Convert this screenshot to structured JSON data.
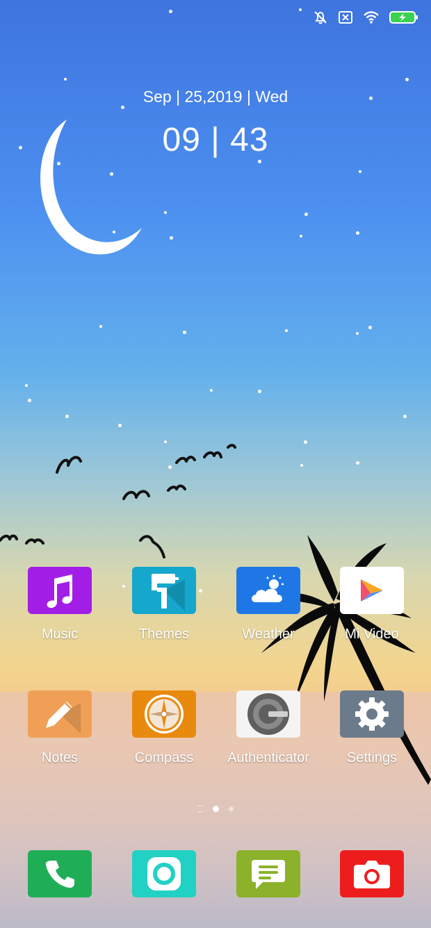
{
  "status_bar": {
    "icons": [
      "mute-icon",
      "no-sim-icon",
      "wifi-icon",
      "battery-charging-icon"
    ]
  },
  "clock": {
    "date": "Sep | 25,2019 | Wed",
    "time": "09 | 43"
  },
  "apps": [
    {
      "label": "Music",
      "icon": "music-note-icon",
      "color": "#a21ee6"
    },
    {
      "label": "Themes",
      "icon": "paint-roller-icon",
      "color": "#16a7cc"
    },
    {
      "label": "Weather",
      "icon": "weather-cloud-sun-icon",
      "color": "#1f77e6"
    },
    {
      "label": "Mi Video",
      "icon": "play-icon",
      "color": "#ffffff"
    },
    {
      "label": "Notes",
      "icon": "pencil-icon",
      "color": "#f0a056"
    },
    {
      "label": "Compass",
      "icon": "compass-icon",
      "color": "#e88a0e"
    },
    {
      "label": "Authenticator",
      "icon": "authenticator-icon",
      "color": "#f4f4f4"
    },
    {
      "label": "Settings",
      "icon": "gear-icon",
      "color": "#6b7b8b"
    }
  ],
  "dock": [
    {
      "name": "phone",
      "icon": "phone-icon",
      "color": "#1fae56"
    },
    {
      "name": "security",
      "icon": "security-ring-icon",
      "color": "#21d1c4"
    },
    {
      "name": "messaging",
      "icon": "message-icon",
      "color": "#8bb22a"
    },
    {
      "name": "camera",
      "icon": "camera-icon",
      "color": "#ee1d1d"
    }
  ],
  "page_indicator": {
    "pages": 2,
    "current": 1
  }
}
